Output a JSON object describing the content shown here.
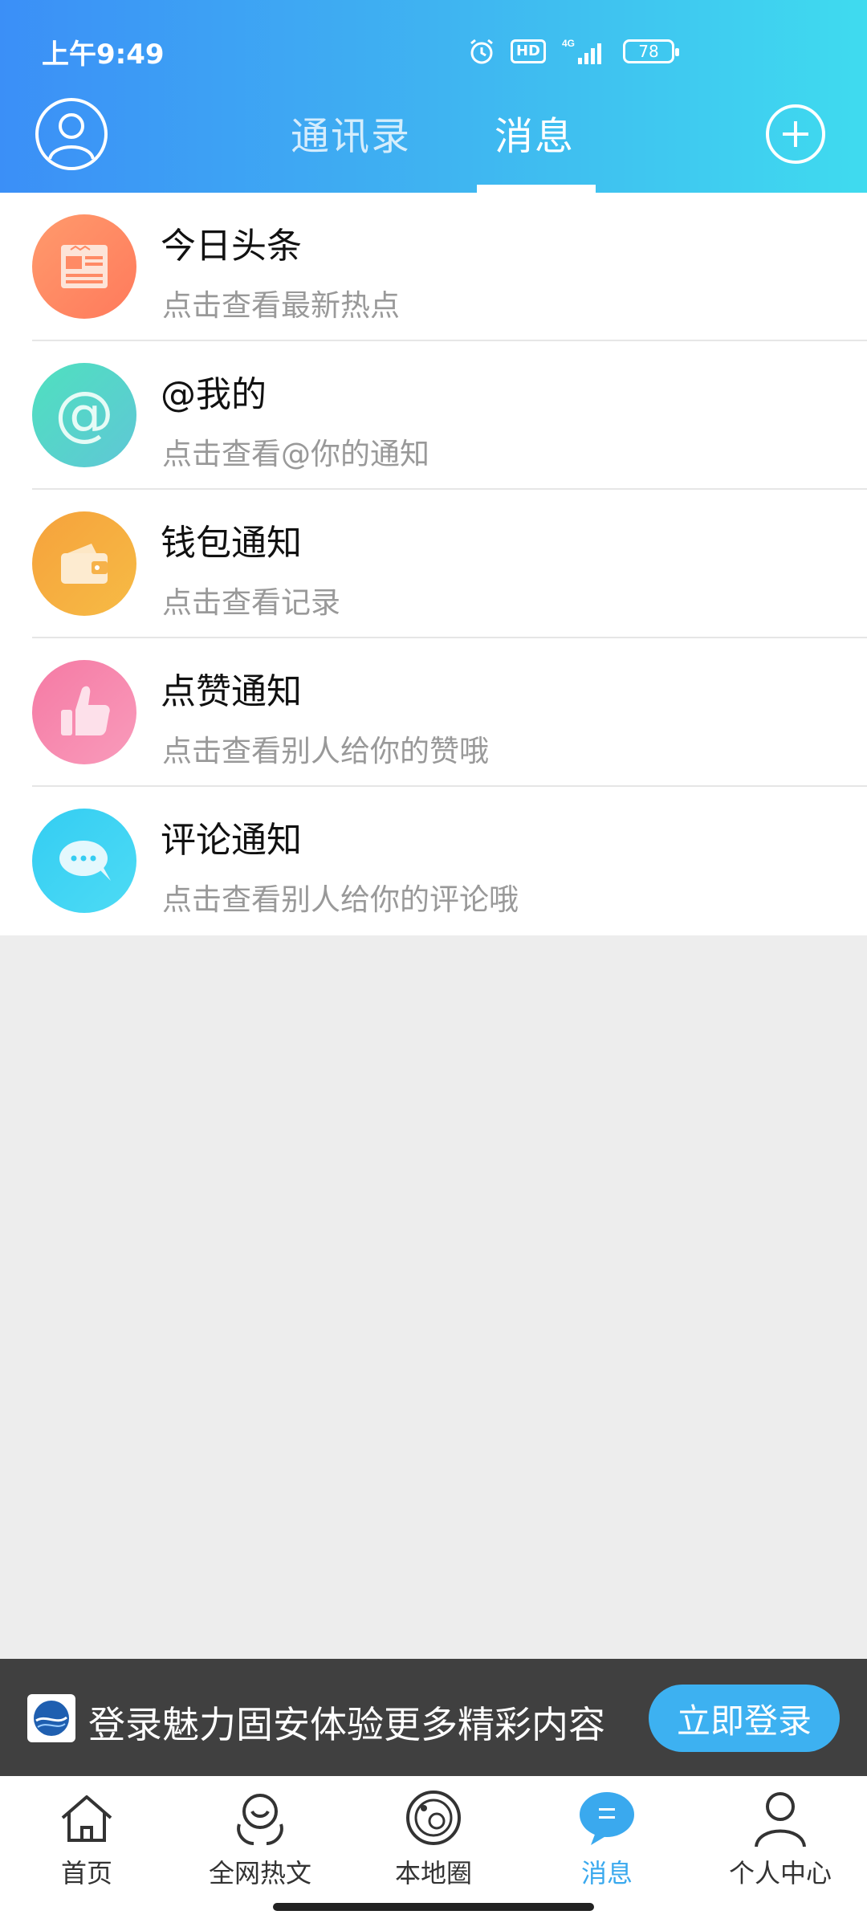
{
  "status_bar": {
    "time": "上午9:49",
    "network": "4G",
    "hd": "HD",
    "battery": "78"
  },
  "header": {
    "tabs": [
      {
        "label": "通讯录",
        "active": false
      },
      {
        "label": "消息",
        "active": true
      }
    ],
    "icons": {
      "left": "profile-icon",
      "right": "add-icon"
    }
  },
  "messages": [
    {
      "title": "今日头条",
      "subtitle": "点击查看最新热点",
      "icon": "newspaper-icon",
      "color": "#ff8a65"
    },
    {
      "title": "@我的",
      "subtitle": "点击查看@你的通知",
      "icon": "at-icon",
      "color": "#4dd4b8"
    },
    {
      "title": "钱包通知",
      "subtitle": "点击查看记录",
      "icon": "wallet-icon",
      "color": "#f6a83a"
    },
    {
      "title": "点赞通知",
      "subtitle": "点击查看别人给你的赞哦",
      "icon": "thumbs-up-icon",
      "color": "#f77fa8"
    },
    {
      "title": "评论通知",
      "subtitle": "点击查看别人给你的评论哦",
      "icon": "comment-icon",
      "color": "#3fd1f3"
    }
  ],
  "login_banner": {
    "text": "登录魅力固安体验更多精彩内容",
    "button": "立即登录"
  },
  "bottom_nav": [
    {
      "label": "首页",
      "icon": "home-icon",
      "active": false
    },
    {
      "label": "全网热文",
      "icon": "hot-articles-icon",
      "active": false
    },
    {
      "label": "本地圈",
      "icon": "local-circle-icon",
      "active": false
    },
    {
      "label": "消息",
      "icon": "message-icon",
      "active": true
    },
    {
      "label": "个人中心",
      "icon": "person-icon",
      "active": false
    }
  ],
  "colors": {
    "header_gradient_start": "#3b8ff7",
    "header_gradient_end": "#3fdbef",
    "accent": "#3aa9ee",
    "banner_bg": "#404040"
  }
}
